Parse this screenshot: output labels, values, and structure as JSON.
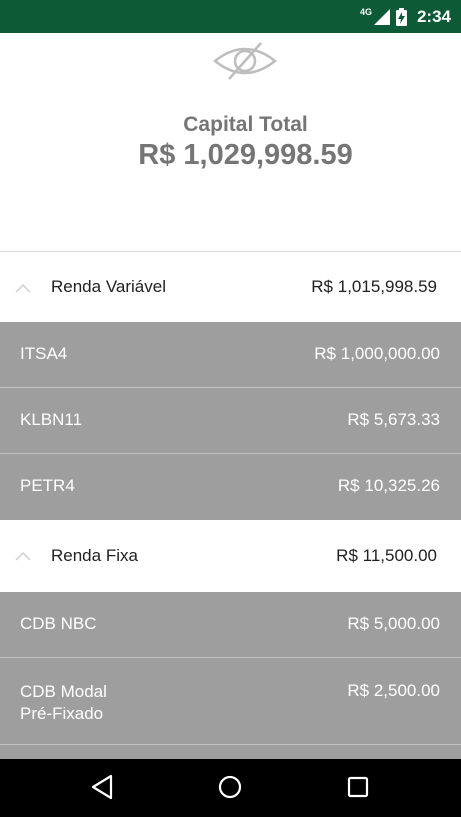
{
  "status_bar": {
    "network": "4G",
    "time": "2:34"
  },
  "header": {
    "visibility_icon": "eye-slash-icon",
    "capital_label": "Capital Total",
    "capital_value": "R$ 1,029,998.59"
  },
  "groups": [
    {
      "name": "Renda Variável",
      "total": "R$ 1,015,998.59",
      "expanded": true,
      "assets": [
        {
          "name": "ITSA4",
          "value": "R$ 1,000,000.00"
        },
        {
          "name": "KLBN11",
          "value": "R$ 5,673.33"
        },
        {
          "name": "PETR4",
          "value": "R$ 10,325.26"
        }
      ]
    },
    {
      "name": "Renda Fixa",
      "total": "R$ 11,500.00",
      "expanded": true,
      "assets": [
        {
          "name": "CDB NBC",
          "value": "R$ 5,000.00"
        },
        {
          "name_line1": "CDB Modal",
          "name_line2": "Pré-Fixado",
          "value": "R$ 2,500.00"
        }
      ]
    }
  ],
  "nav_bar": {
    "back_icon": "triangle-back-icon",
    "home_icon": "circle-home-icon",
    "recents_icon": "square-recents-icon"
  },
  "colors": {
    "status_bar": "#0c5a36",
    "asset_row": "#9e9e9e",
    "capital_text": "#757575"
  }
}
